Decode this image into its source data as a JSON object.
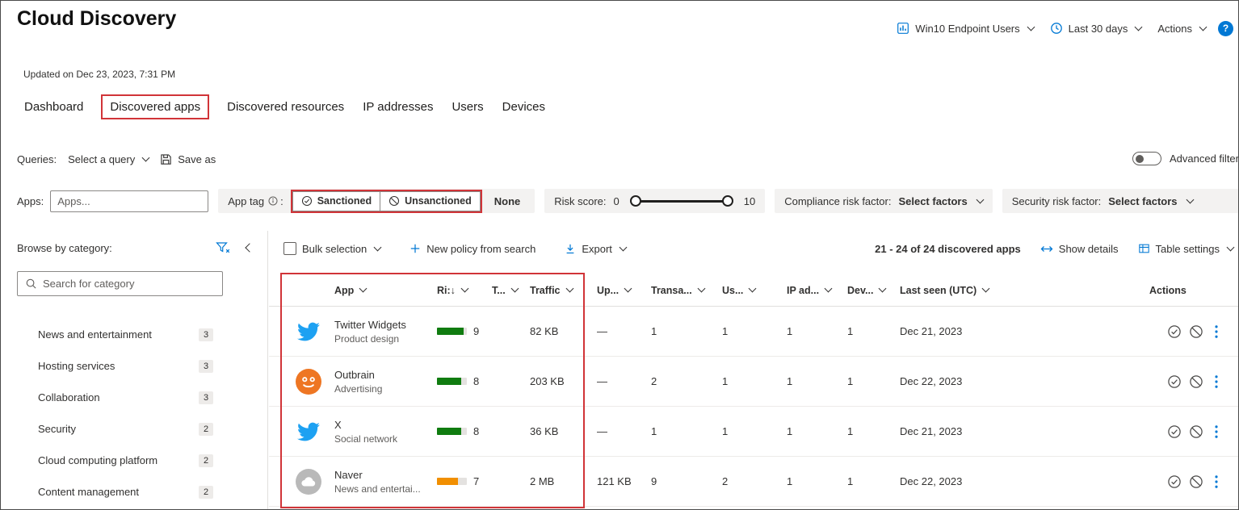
{
  "colors": {
    "accent": "#0078d4",
    "annotation": "#d13438",
    "risk_green": "#107c10",
    "risk_orange": "#f18f01",
    "twitter_blue": "#1da1f2",
    "outbrain_orange": "#ee7623",
    "naver_gray": "#b9b9b9"
  },
  "header": {
    "title": "Cloud Discovery",
    "updated": "Updated on Dec 23, 2023, 7:31 PM",
    "stream": "Win10 Endpoint Users",
    "time_range": "Last 30 days",
    "actions": "Actions",
    "help": "?"
  },
  "tabs": [
    {
      "label": "Dashboard",
      "active": false
    },
    {
      "label": "Discovered apps",
      "active": true
    },
    {
      "label": "Discovered resources",
      "active": false
    },
    {
      "label": "IP addresses",
      "active": false
    },
    {
      "label": "Users",
      "active": false
    },
    {
      "label": "Devices",
      "active": false
    }
  ],
  "queries": {
    "label": "Queries:",
    "select_query": "Select a query",
    "save_as": "Save as",
    "advanced_filter": "Advanced filters"
  },
  "filters": {
    "apps_label": "Apps:",
    "apps_placeholder": "Apps...",
    "app_tag_label": "App tag",
    "app_tag_colon": ":",
    "sanctioned": "Sanctioned",
    "unsanctioned": "Unsanctioned",
    "none": "None",
    "risk_label": "Risk score:",
    "risk_min": "0",
    "risk_max": "10",
    "compliance_label": "Compliance risk factor:",
    "compliance_value": "Select factors",
    "security_label": "Security risk factor:",
    "security_value": "Select factors"
  },
  "sidebar": {
    "title": "Browse by category:",
    "search_placeholder": "Search for category",
    "categories": [
      {
        "label": "News and entertainment",
        "count": "3"
      },
      {
        "label": "Hosting services",
        "count": "3"
      },
      {
        "label": "Collaboration",
        "count": "3"
      },
      {
        "label": "Security",
        "count": "2"
      },
      {
        "label": "Cloud computing platform",
        "count": "2"
      },
      {
        "label": "Content management",
        "count": "2"
      }
    ]
  },
  "toolbar": {
    "bulk_selection": "Bulk selection",
    "new_policy": "New policy from search",
    "export": "Export",
    "count": "21 - 24 of 24 discovered apps",
    "show_details": "Show details",
    "table_settings": "Table settings"
  },
  "table": {
    "columns": [
      "App",
      "Ri:↓",
      "T...",
      "Traffic",
      "Up...",
      "Transa...",
      "Us...",
      "IP ad...",
      "Dev...",
      "Last seen (UTC)",
      "Actions"
    ],
    "rows": [
      {
        "icon": "twitter",
        "app": "Twitter Widgets",
        "category": "Product design",
        "risk": "9",
        "risk_color": "risk_green",
        "traffic": "82 KB",
        "upload": "—",
        "transactions": "1",
        "users": "1",
        "ip_addresses": "1",
        "devices": "1",
        "last_seen": "Dec 21, 2023"
      },
      {
        "icon": "outbrain",
        "app": "Outbrain",
        "category": "Advertising",
        "risk": "8",
        "risk_color": "risk_green",
        "traffic": "203 KB",
        "upload": "—",
        "transactions": "2",
        "users": "1",
        "ip_addresses": "1",
        "devices": "1",
        "last_seen": "Dec 22, 2023"
      },
      {
        "icon": "twitter",
        "app": "X",
        "category": "Social network",
        "risk": "8",
        "risk_color": "risk_green",
        "traffic": "36 KB",
        "upload": "—",
        "transactions": "1",
        "users": "1",
        "ip_addresses": "1",
        "devices": "1",
        "last_seen": "Dec 21, 2023"
      },
      {
        "icon": "naver",
        "app": "Naver",
        "category": "News and entertai...",
        "risk": "7",
        "risk_color": "risk_orange",
        "traffic": "2 MB",
        "upload": "121 KB",
        "transactions": "9",
        "users": "2",
        "ip_addresses": "1",
        "devices": "1",
        "last_seen": "Dec 22, 2023"
      }
    ]
  }
}
